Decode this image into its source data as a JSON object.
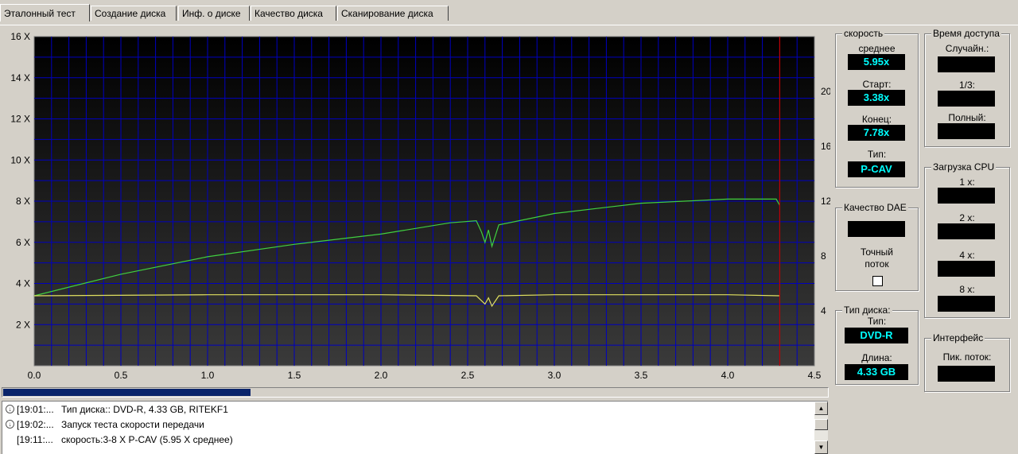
{
  "tabs": [
    {
      "label": "Эталонный тест",
      "active": true
    },
    {
      "label": "Создание диска",
      "active": false
    },
    {
      "label": "Инф. о диске",
      "active": false
    },
    {
      "label": "Качество диска",
      "active": false
    },
    {
      "label": "Сканирование диска",
      "active": false
    }
  ],
  "chart_data": {
    "type": "line",
    "x_ticks": [
      "0.0",
      "0.5",
      "1.0",
      "1.5",
      "2.0",
      "2.5",
      "3.0",
      "3.5",
      "4.0",
      "4.5"
    ],
    "xlim": [
      0,
      4.5
    ],
    "y_left_ticks": [
      "16 X",
      "14 X",
      "12 X",
      "10 X",
      "8 X",
      "6 X",
      "4 X",
      "2 X"
    ],
    "ylim_left": [
      0,
      16
    ],
    "y_right_ticks": [
      "20",
      "16",
      "12",
      "8",
      "4"
    ],
    "ylim_right": [
      0,
      24
    ],
    "grid": true,
    "end_marker_x": 4.3,
    "series": [
      {
        "color": "#40d040",
        "x": [
          0.0,
          0.5,
          1.0,
          1.5,
          2.0,
          2.4,
          2.55,
          2.58,
          2.6,
          2.62,
          2.64,
          2.68,
          3.0,
          3.5,
          4.0,
          4.28,
          4.3
        ],
        "y": [
          3.4,
          4.45,
          5.3,
          5.9,
          6.4,
          6.95,
          7.05,
          6.5,
          6.0,
          6.6,
          5.8,
          6.85,
          7.4,
          7.9,
          8.1,
          8.1,
          7.8
        ]
      },
      {
        "color": "#e0e060",
        "x": [
          0.0,
          1.0,
          2.0,
          2.55,
          2.6,
          2.62,
          2.64,
          2.68,
          3.0,
          4.0,
          4.3
        ],
        "y": [
          3.4,
          3.45,
          3.45,
          3.4,
          3.0,
          3.3,
          2.9,
          3.4,
          3.45,
          3.45,
          3.4
        ]
      }
    ]
  },
  "progress": {
    "fraction": 0.3
  },
  "log": [
    {
      "time": "[19:01:...",
      "msg": "Тип диска:: DVD-R, 4.33 GB, RITEKF1",
      "icon": true
    },
    {
      "time": "[19:02:...",
      "msg": "Запуск теста скорости передачи",
      "icon": true
    },
    {
      "time": "[19:11:...",
      "msg": "скорость:3-8 X P-CAV (5.95 X среднее)",
      "icon": false
    }
  ],
  "speed": {
    "title": "скорость",
    "avg_label": "среднее",
    "avg_value": "5.95x",
    "start_label": "Старт:",
    "start_value": "3.38x",
    "end_label": "Конец:",
    "end_value": "7.78x",
    "type_label": "Тип:",
    "type_value": "P-CAV"
  },
  "access": {
    "title": "Время доступа",
    "random_label": "Случайн.:",
    "random_value": "",
    "third_label": "1/3:",
    "third_value": "",
    "full_label": "Полный:",
    "full_value": ""
  },
  "dae": {
    "title": "Качество DAE",
    "value": "",
    "accurate_label_1": "Точный",
    "accurate_label_2": "поток",
    "accurate_checked": false
  },
  "cpu": {
    "title": "Загрузка CPU",
    "x1_label": "1 x:",
    "x1_value": "",
    "x2_label": "2 x:",
    "x2_value": "",
    "x4_label": "4 x:",
    "x4_value": "",
    "x8_label": "8 x:",
    "x8_value": ""
  },
  "disc": {
    "title": "Тип диска:",
    "type_label": "Тип:",
    "type_value": "DVD-R",
    "length_label": "Длина:",
    "length_value": "4.33 GB"
  },
  "iface": {
    "title": "Интерфейс",
    "burst_label": "Пик. поток:",
    "burst_value": ""
  },
  "colors": {
    "plot_bg_top": "#000000",
    "plot_bg_bottom": "#3a3a3a",
    "grid": "#0000c0",
    "value_text": "#00ffff",
    "end_marker": "#c00000"
  }
}
